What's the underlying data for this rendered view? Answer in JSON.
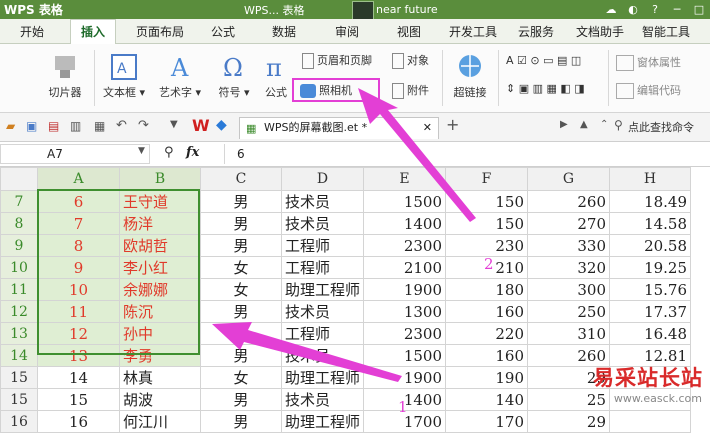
{
  "titlebar": {
    "app_name": "WPS 表格",
    "doc_title": "WPS... 表格",
    "user_name": "near future"
  },
  "tabs": [
    "开始",
    "插入",
    "页面布局",
    "公式",
    "数据",
    "审阅",
    "视图",
    "开发工具",
    "云服务",
    "文档助手",
    "智能工具"
  ],
  "ribbon": {
    "slicer": "切片器",
    "textbox": "文本框",
    "wordart": "艺术字",
    "symbol": "符号",
    "formula": "公式",
    "header_footer": "页眉和页脚",
    "object": "对象",
    "camera": "照相机",
    "attachment": "附件",
    "hyperlink": "超链接",
    "window_properties": "窗体属性",
    "edit_code": "编辑代码"
  },
  "toolbar2": {
    "doc_tab": "WPS的屏幕截图.et *",
    "search_hint": "点此查找命令"
  },
  "formula_bar": {
    "cell_ref": "A7",
    "fx": "fx",
    "value": "6"
  },
  "sheet": {
    "columns": [
      "A",
      "B",
      "C",
      "D",
      "E",
      "F",
      "G",
      "H"
    ],
    "rows": [
      {
        "n": "7",
        "a": "6",
        "b": "王守道",
        "c": "男",
        "d": "技术员",
        "e": "1500",
        "f": "150",
        "g": "260",
        "h": "18.49"
      },
      {
        "n": "8",
        "a": "7",
        "b": "杨洋",
        "c": "男",
        "d": "技术员",
        "e": "1400",
        "f": "150",
        "g": "270",
        "h": "14.58"
      },
      {
        "n": "9",
        "a": "8",
        "b": "欧胡哲",
        "c": "男",
        "d": "工程师",
        "e": "2300",
        "f": "230",
        "g": "330",
        "h": "20.58"
      },
      {
        "n": "10",
        "a": "9",
        "b": "李小红",
        "c": "女",
        "d": "工程师",
        "e": "2100",
        "f": "210",
        "g": "320",
        "h": "19.25"
      },
      {
        "n": "11",
        "a": "10",
        "b": "余娜娜",
        "c": "女",
        "d": "助理工程师",
        "e": "1900",
        "f": "180",
        "g": "300",
        "h": "15.76"
      },
      {
        "n": "12",
        "a": "11",
        "b": "陈沉",
        "c": "男",
        "d": "技术员",
        "e": "1300",
        "f": "160",
        "g": "250",
        "h": "17.37"
      },
      {
        "n": "13",
        "a": "12",
        "b": "孙中",
        "c": "女",
        "d": "工程师",
        "e": "2300",
        "f": "220",
        "g": "310",
        "h": "16.48"
      },
      {
        "n": "14",
        "a": "13",
        "b": "李勇",
        "c": "男",
        "d": "技术员",
        "e": "1500",
        "f": "160",
        "g": "260",
        "h": "12.81"
      },
      {
        "n": "15",
        "a": "14",
        "b": "林真",
        "c": "女",
        "d": "助理工程师",
        "e": "1900",
        "f": "190",
        "g": "29",
        "h": ""
      },
      {
        "n": "15",
        "a": "15",
        "b": "胡波",
        "c": "男",
        "d": "技术员",
        "e": "1400",
        "f": "140",
        "g": "25",
        "h": ""
      },
      {
        "n": "16",
        "a": "16",
        "b": "何江川",
        "c": "男",
        "d": "助理工程师",
        "e": "1700",
        "f": "170",
        "g": "29",
        "h": ""
      }
    ]
  },
  "annotations": {
    "marker_2": "2",
    "marker_1": "1"
  },
  "watermark": {
    "line1": "易采站长站",
    "line2": "www.easck.com"
  },
  "colors": {
    "title_green": "#5a8d3c",
    "selection_green": "#3f8f2f",
    "arrow_magenta": "#e33fd5",
    "selected_text_red": "#e03a2a"
  }
}
